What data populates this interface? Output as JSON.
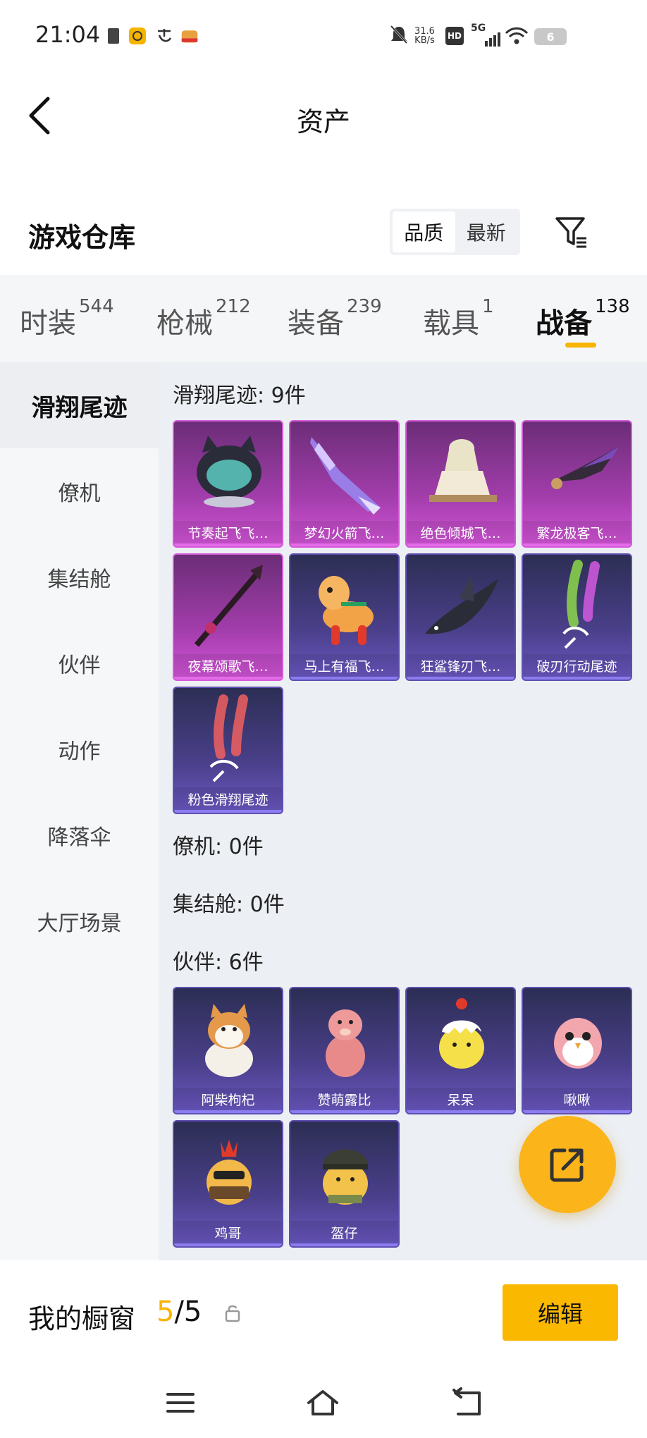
{
  "status_bar": {
    "time": "21:04",
    "network_speed_top": "31.6",
    "network_speed_unit": "KB/s",
    "hd_label": "HD",
    "signal_label": "5G",
    "battery": "6"
  },
  "header": {
    "title": "资产"
  },
  "warehouse": {
    "title": "游戏仓库",
    "sort_options": [
      "品质",
      "最新"
    ]
  },
  "category_tabs": [
    {
      "label": "时装",
      "count": "544"
    },
    {
      "label": "枪械",
      "count": "212"
    },
    {
      "label": "装备",
      "count": "239"
    },
    {
      "label": "载具",
      "count": "1"
    },
    {
      "label": "战备",
      "count": "138"
    }
  ],
  "sidebar": {
    "items": [
      "滑翔尾迹",
      "僚机",
      "集结舱",
      "伙伴",
      "动作",
      "降落伞",
      "大厅场景"
    ]
  },
  "sections": {
    "trails": {
      "title": "滑翔尾迹: 9件",
      "items": [
        {
          "name": "节奏起飞飞…",
          "style": "purple",
          "icon": "cat-helmet-icon"
        },
        {
          "name": "梦幻火箭飞…",
          "style": "purple",
          "icon": "rocket-wing-icon"
        },
        {
          "name": "绝色倾城飞…",
          "style": "purple",
          "icon": "goddess-icon"
        },
        {
          "name": "繁龙极客飞…",
          "style": "purple",
          "icon": "dragon-wing-icon"
        },
        {
          "name": "夜幕颂歌飞…",
          "style": "purple",
          "icon": "spear-icon"
        },
        {
          "name": "马上有福飞…",
          "style": "blue",
          "icon": "horse-icon"
        },
        {
          "name": "狂鲨锋刃飞…",
          "style": "blue",
          "icon": "shark-icon"
        },
        {
          "name": "破刃行动尾迹",
          "style": "blue",
          "icon": "green-smoke-icon"
        },
        {
          "name": "粉色滑翔尾迹",
          "style": "blue",
          "icon": "pink-smoke-icon"
        }
      ]
    },
    "wingman": {
      "title": "僚机: 0件"
    },
    "pod": {
      "title": "集结舱: 0件"
    },
    "companions": {
      "title": "伙伴: 6件",
      "items": [
        {
          "name": "阿柴枸杞",
          "style": "blue",
          "icon": "shiba-icon"
        },
        {
          "name": "赞萌露比",
          "style": "blue",
          "icon": "beaver-icon"
        },
        {
          "name": "呆呆",
          "style": "blue",
          "icon": "chick-icon"
        },
        {
          "name": "啾啾",
          "style": "blue",
          "icon": "bird-icon"
        },
        {
          "name": "鸡哥",
          "style": "blue",
          "icon": "rooster-icon"
        },
        {
          "name": "盔仔",
          "style": "blue",
          "icon": "helmet-chick-icon"
        }
      ]
    }
  },
  "bottom_bar": {
    "showcase_label": "我的橱窗",
    "showcase_current": "5",
    "showcase_total": "/5",
    "edit_label": "编辑"
  },
  "colors": {
    "accent": "#fbb800",
    "rare_purple": "#a23dab",
    "epic_blue": "#4a3f8a"
  }
}
